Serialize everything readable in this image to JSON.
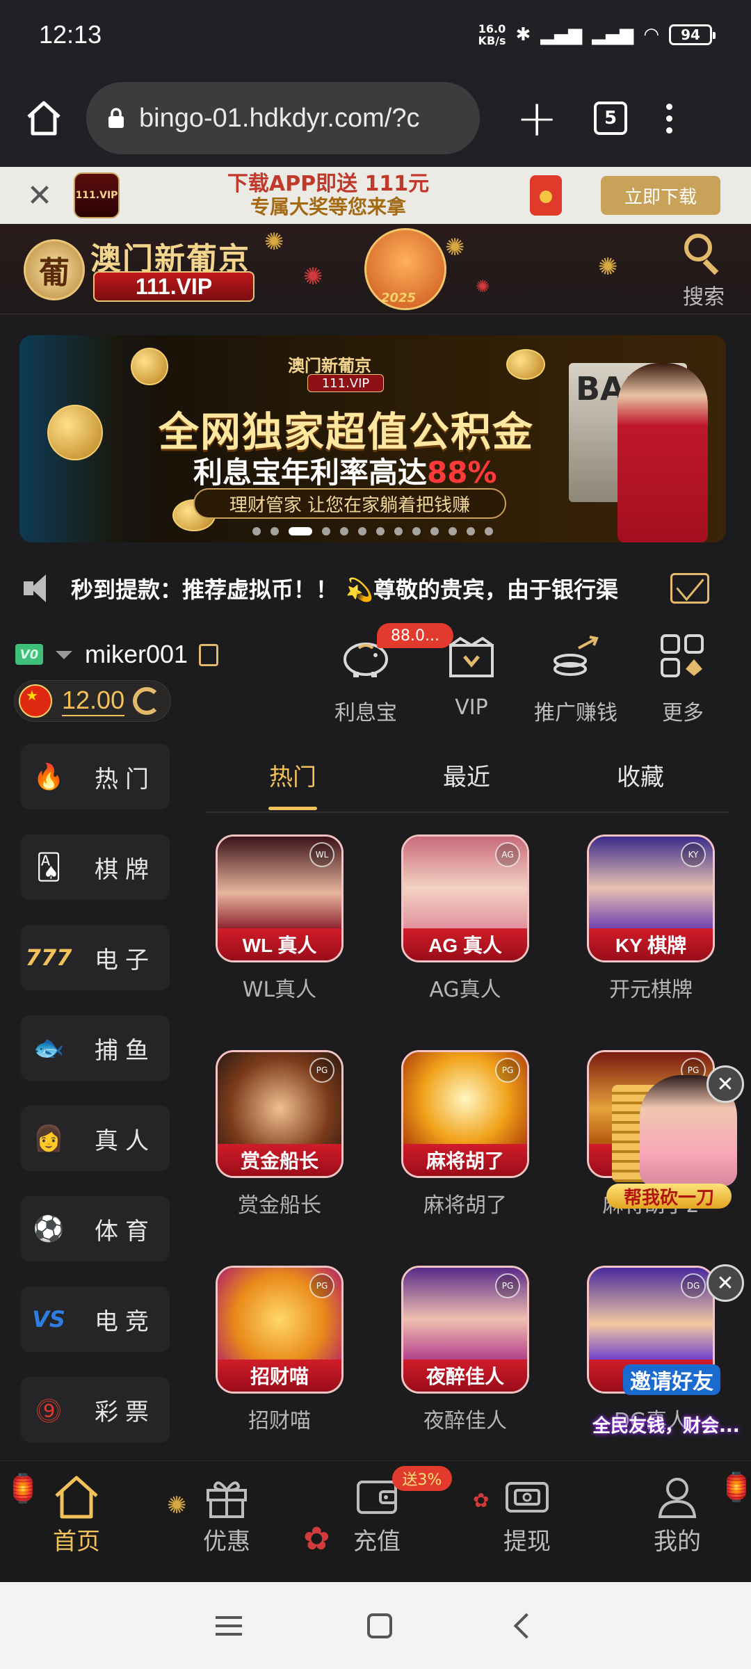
{
  "status_bar": {
    "time": "12:13",
    "net_speed_top": "16.0",
    "net_speed_unit": "KB/s",
    "battery": "94"
  },
  "browser": {
    "url": "bingo-01.hdkdyr.com/?c",
    "tab_count": "5"
  },
  "download_banner": {
    "app_icon_text": "111.VIP",
    "line1": "下载APP即送 111元",
    "line2": "专属大奖等您来拿",
    "button": "立即下载"
  },
  "site_header": {
    "brand": "澳门新葡京",
    "vip_text": "111.VIP",
    "mascot_year": "2025",
    "search_label": "搜索"
  },
  "promo_banner": {
    "brand": "澳门新葡京",
    "brand_vip": "111.VIP",
    "title": "全网独家超值公积金",
    "rate_text": "利息宝年利率高达",
    "rate_value": "88%",
    "subtitle": "理财管家 让您在家躺着把钱赚",
    "bank_text": "BANK",
    "slide_count": 13,
    "active_slide": 3
  },
  "marquee": {
    "text": "秒到提款：推荐虚拟币！！  💫尊敬的贵宾，由于银行渠"
  },
  "user": {
    "vip_level": "V0",
    "username": "miker001",
    "balance": "12.00"
  },
  "quick_actions": [
    {
      "label": "利息宝",
      "icon": "piggy-bank-icon",
      "badge": "88.0..."
    },
    {
      "label": "VIP",
      "icon": "crown-icon"
    },
    {
      "label": "推广赚钱",
      "icon": "coins-hand-icon"
    },
    {
      "label": "更多",
      "icon": "grid-more-icon"
    }
  ],
  "sidebar": {
    "items": [
      {
        "label": "热门",
        "icon": "fire-icon"
      },
      {
        "label": "棋牌",
        "icon": "cards-icon"
      },
      {
        "label": "电子",
        "icon": "slot-777-icon"
      },
      {
        "label": "捕鱼",
        "icon": "fish-icon"
      },
      {
        "label": "真人",
        "icon": "live-dealer-icon"
      },
      {
        "label": "体育",
        "icon": "soccer-ball-icon"
      },
      {
        "label": "电竞",
        "icon": "versus-icon"
      },
      {
        "label": "彩票",
        "icon": "lottery-balls-icon"
      }
    ]
  },
  "content_tabs": [
    {
      "label": "热门"
    },
    {
      "label": "最近"
    },
    {
      "label": "收藏"
    }
  ],
  "games": [
    {
      "strip": "WL 真人",
      "name": "WL真人",
      "corner": "WL"
    },
    {
      "strip": "AG 真人",
      "name": "AG真人",
      "corner": "AG"
    },
    {
      "strip": "KY 棋牌",
      "name": "开元棋牌",
      "corner": "KY"
    },
    {
      "strip": "赏金船长",
      "name": "赏金船长",
      "corner": "PG"
    },
    {
      "strip": "麻将胡了",
      "name": "麻将胡了",
      "corner": "PG"
    },
    {
      "strip": "麻",
      "name": "麻将胡了2",
      "corner": "PG"
    },
    {
      "strip": "招财喵",
      "name": "招财喵",
      "corner": "PG"
    },
    {
      "strip": "夜醉佳人",
      "name": "夜醉佳人",
      "corner": "PG"
    },
    {
      "strip": "D",
      "name": "DG真人",
      "corner": "DG"
    }
  ],
  "floating": {
    "promo1_label": "帮我砍一刀",
    "promo2_label": "邀请好友",
    "promo2_sub": "全民友钱，财会..."
  },
  "bottom_nav": {
    "items": [
      {
        "label": "首页",
        "icon": "home-icon"
      },
      {
        "label": "优惠",
        "icon": "gift-icon"
      },
      {
        "label": "充值",
        "icon": "wallet-icon"
      },
      {
        "label": "提现",
        "icon": "withdraw-ticket-icon"
      },
      {
        "label": "我的",
        "icon": "profile-icon"
      }
    ],
    "deposit_badge": "送3%"
  },
  "colors": {
    "accent_gold": "#f3c15a",
    "red": "#d01c2a",
    "background": "#1c1c1e"
  }
}
